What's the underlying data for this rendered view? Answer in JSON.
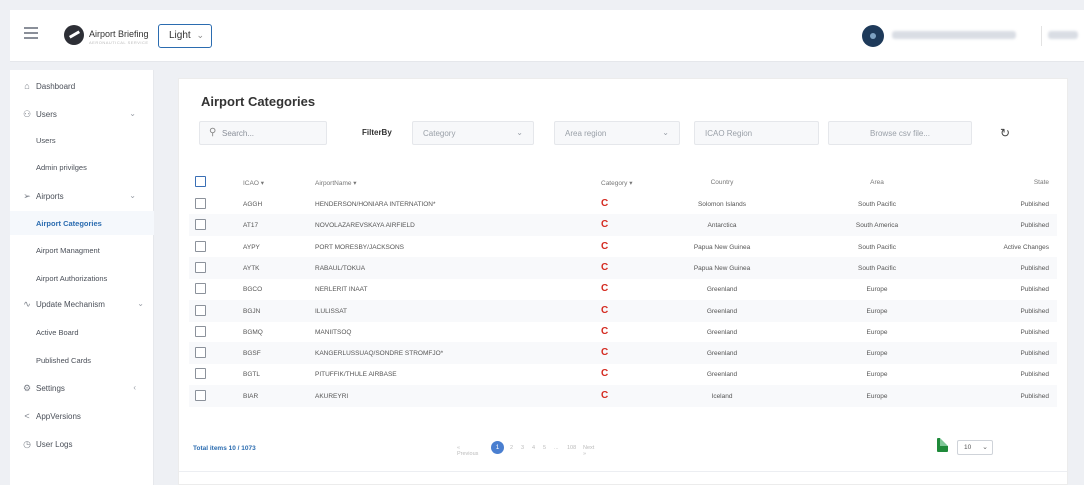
{
  "header": {
    "brand_name": "Airport Briefing",
    "brand_tagline": "AERONAUTICAL SERVICE",
    "theme_value": "Light"
  },
  "sidebar": {
    "dashboard": "Dashboard",
    "users": "Users",
    "users_sub": [
      "Users",
      "Admin privilges"
    ],
    "airports": "Airports",
    "airports_sub": [
      "Airport Categories",
      "Airport Managment",
      "Airport Authorizations"
    ],
    "update_mechanism": "Update Mechanism",
    "update_sub": [
      "Active Board",
      "Published Cards"
    ],
    "settings": "Settings",
    "app_versions": "AppVersions",
    "user_logs": "User Logs"
  },
  "main": {
    "title": "Airport Categories",
    "search_placeholder": "Search...",
    "filter_label": "FilterBy",
    "category_placeholder": "Category",
    "area_placeholder": "Area region",
    "icao_region_placeholder": "ICAO Region",
    "browse_placeholder": "Browse csv file..."
  },
  "table": {
    "headers": {
      "icao": "ICAO",
      "name": "AirportName",
      "category": "Category",
      "country": "Country",
      "area": "Area",
      "state": "State"
    },
    "rows": [
      {
        "icao": "AGGH",
        "name": "HENDERSON/HONIARA INTERNATION*",
        "category": "C",
        "country": "Solomon Islands",
        "area": "South Pacific",
        "state": "Published"
      },
      {
        "icao": "AT17",
        "name": "NOVOLAZAREVSKAYA AIRFIELD",
        "category": "C",
        "country": "Antarctica",
        "area": "South America",
        "state": "Published"
      },
      {
        "icao": "AYPY",
        "name": "PORT MORESBY/JACKSONS",
        "category": "C",
        "country": "Papua New Guinea",
        "area": "South Pacific",
        "state": "Active Changes"
      },
      {
        "icao": "AYTK",
        "name": "RABAUL/TOKUA",
        "category": "C",
        "country": "Papua New Guinea",
        "area": "South Pacific",
        "state": "Published"
      },
      {
        "icao": "BGCO",
        "name": "NERLERIT INAAT",
        "category": "C",
        "country": "Greenland",
        "area": "Europe",
        "state": "Published"
      },
      {
        "icao": "BGJN",
        "name": "ILULISSAT",
        "category": "C",
        "country": "Greenland",
        "area": "Europe",
        "state": "Published"
      },
      {
        "icao": "BGMQ",
        "name": "MANIITSOQ",
        "category": "C",
        "country": "Greenland",
        "area": "Europe",
        "state": "Published"
      },
      {
        "icao": "BGSF",
        "name": "KANGERLUSSUAQ/SONDRE STROMFJO*",
        "category": "C",
        "country": "Greenland",
        "area": "Europe",
        "state": "Published"
      },
      {
        "icao": "BGTL",
        "name": "PITUFFIK/THULE AIRBASE",
        "category": "C",
        "country": "Greenland",
        "area": "Europe",
        "state": "Published"
      },
      {
        "icao": "BIAR",
        "name": "AKUREYRI",
        "category": "C",
        "country": "Iceland",
        "area": "Europe",
        "state": "Published"
      }
    ]
  },
  "footer": {
    "total_items": "Total items 10 / 1073",
    "prev_label": "« Previous",
    "pages": [
      "1",
      "2",
      "3",
      "4",
      "5",
      "...",
      "108"
    ],
    "next_label": "Next »",
    "page_size": "10"
  },
  "colors": {
    "accent": "#2b6cb0",
    "category_c": "#d42a20"
  }
}
